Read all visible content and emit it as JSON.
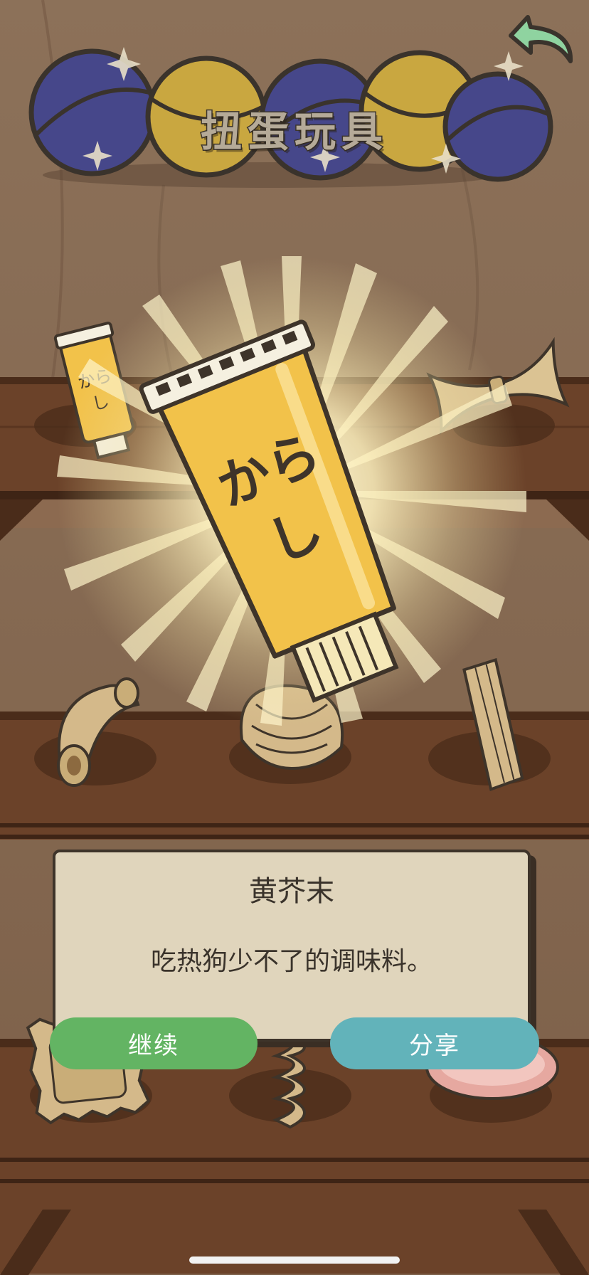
{
  "screen": {
    "title": "扭蛋玩具",
    "back_button": "back-arrow-icon"
  },
  "featured_item": {
    "tube_label": "からし",
    "name": "黄芥末",
    "description": "吃热狗少不了的调味料。"
  },
  "shelf_items": [
    "mustard-tube",
    "mustard-tube",
    "farfalle-pasta",
    "macaroni-pasta",
    "conchiglie-pasta",
    "penne-pasta",
    "ravioli-pasta",
    "fusilli-pasta",
    "ham-slice"
  ],
  "buttons": {
    "continue": "继续",
    "share": "分享"
  },
  "colors": {
    "background": "#8a6e55",
    "shelf": "#6b4229",
    "card": "#e0d5bc",
    "continue": "#63b463",
    "share": "#62b3ba",
    "capsule_blue": "#46478a",
    "capsule_yellow": "#c9a740",
    "mustard": "#f2c24a"
  }
}
